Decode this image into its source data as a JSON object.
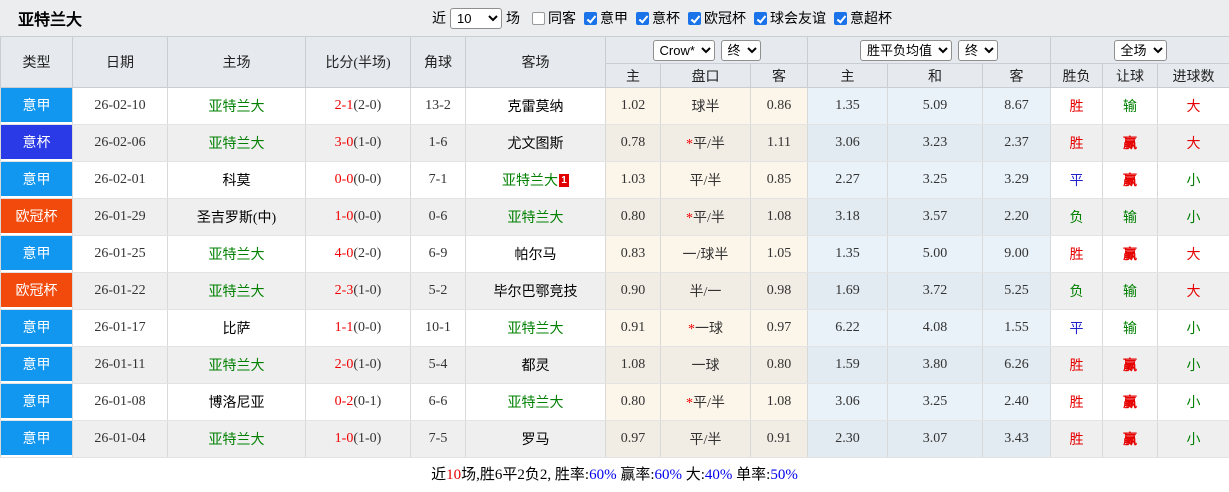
{
  "title": "亚特兰大",
  "topbar": {
    "recent_label": "近",
    "match_count": "10",
    "matches_label": "场",
    "checkboxes": [
      {
        "label": "同客",
        "checked": false
      },
      {
        "label": "意甲",
        "checked": true
      },
      {
        "label": "意杯",
        "checked": true
      },
      {
        "label": "欧冠杯",
        "checked": true
      },
      {
        "label": "球会友谊",
        "checked": true
      },
      {
        "label": "意超杯",
        "checked": true
      }
    ]
  },
  "table": {
    "headers": {
      "type": "类型",
      "date": "日期",
      "home": "主场",
      "score": "比分(半场)",
      "corners": "角球",
      "away": "客场",
      "sub": [
        "主",
        "盘口",
        "客",
        "主",
        "和",
        "客",
        "胜负",
        "让球",
        "进球数"
      ]
    },
    "selectors": {
      "bookmaker": "Crow*",
      "handicap_time": "终",
      "odds_avg": "胜平负均值",
      "odds_time": "终",
      "scope": "全场"
    },
    "type_colors": {
      "意甲": "#1297f0",
      "意杯": "#2a3ae6",
      "欧冠杯": "#f24a0c"
    },
    "rows": [
      {
        "type": "意甲",
        "date": "26-02-10",
        "home": "亚特兰大",
        "home_team": true,
        "score": "2-1",
        "half": "(2-0)",
        "corners": "13-2",
        "away": "克雷莫纳",
        "away_team": false,
        "away_card": "",
        "ah": {
          "home": "1.02",
          "star": false,
          "line": "球半",
          "away": "0.86"
        },
        "eu": {
          "home": "1.35",
          "draw": "5.09",
          "away": "8.67"
        },
        "result": {
          "text": "胜",
          "color": "red"
        },
        "handicap": {
          "text": "输",
          "color": "green"
        },
        "goals": {
          "text": "大",
          "color": "red"
        }
      },
      {
        "type": "意杯",
        "date": "26-02-06",
        "home": "亚特兰大",
        "home_team": true,
        "score": "3-0",
        "half": "(1-0)",
        "corners": "1-6",
        "away": "尤文图斯",
        "away_team": false,
        "away_card": "",
        "ah": {
          "home": "0.78",
          "star": true,
          "line": "平/半",
          "away": "1.11"
        },
        "eu": {
          "home": "3.06",
          "draw": "3.23",
          "away": "2.37"
        },
        "result": {
          "text": "胜",
          "color": "red"
        },
        "handicap": {
          "text": "赢",
          "color": "red"
        },
        "goals": {
          "text": "大",
          "color": "red"
        }
      },
      {
        "type": "意甲",
        "date": "26-02-01",
        "home": "科莫",
        "home_team": false,
        "score": "0-0",
        "half": "(0-0)",
        "corners": "7-1",
        "away": "亚特兰大",
        "away_team": true,
        "away_card": "1",
        "ah": {
          "home": "1.03",
          "star": false,
          "line": "平/半",
          "away": "0.85"
        },
        "eu": {
          "home": "2.27",
          "draw": "3.25",
          "away": "3.29"
        },
        "result": {
          "text": "平",
          "color": "blue"
        },
        "handicap": {
          "text": "赢",
          "color": "red"
        },
        "goals": {
          "text": "小",
          "color": "green"
        }
      },
      {
        "type": "欧冠杯",
        "date": "26-01-29",
        "home": "圣吉罗斯(中)",
        "home_team": false,
        "score": "1-0",
        "half": "(0-0)",
        "corners": "0-6",
        "away": "亚特兰大",
        "away_team": true,
        "away_card": "",
        "ah": {
          "home": "0.80",
          "star": true,
          "line": "平/半",
          "away": "1.08"
        },
        "eu": {
          "home": "3.18",
          "draw": "3.57",
          "away": "2.20"
        },
        "result": {
          "text": "负",
          "color": "green"
        },
        "handicap": {
          "text": "输",
          "color": "green"
        },
        "goals": {
          "text": "小",
          "color": "green"
        }
      },
      {
        "type": "意甲",
        "date": "26-01-25",
        "home": "亚特兰大",
        "home_team": true,
        "score": "4-0",
        "half": "(2-0)",
        "corners": "6-9",
        "away": "帕尔马",
        "away_team": false,
        "away_card": "",
        "ah": {
          "home": "0.83",
          "star": false,
          "line": "一/球半",
          "away": "1.05"
        },
        "eu": {
          "home": "1.35",
          "draw": "5.00",
          "away": "9.00"
        },
        "result": {
          "text": "胜",
          "color": "red"
        },
        "handicap": {
          "text": "赢",
          "color": "red"
        },
        "goals": {
          "text": "大",
          "color": "red"
        }
      },
      {
        "type": "欧冠杯",
        "date": "26-01-22",
        "home": "亚特兰大",
        "home_team": true,
        "score": "2-3",
        "half": "(1-0)",
        "corners": "5-2",
        "away": "毕尔巴鄂竞技",
        "away_team": false,
        "away_card": "",
        "ah": {
          "home": "0.90",
          "star": false,
          "line": "半/一",
          "away": "0.98"
        },
        "eu": {
          "home": "1.69",
          "draw": "3.72",
          "away": "5.25"
        },
        "result": {
          "text": "负",
          "color": "green"
        },
        "handicap": {
          "text": "输",
          "color": "green"
        },
        "goals": {
          "text": "大",
          "color": "red"
        }
      },
      {
        "type": "意甲",
        "date": "26-01-17",
        "home": "比萨",
        "home_team": false,
        "score": "1-1",
        "half": "(0-0)",
        "corners": "10-1",
        "away": "亚特兰大",
        "away_team": true,
        "away_card": "",
        "ah": {
          "home": "0.91",
          "star": true,
          "line": "一球",
          "away": "0.97"
        },
        "eu": {
          "home": "6.22",
          "draw": "4.08",
          "away": "1.55"
        },
        "result": {
          "text": "平",
          "color": "blue"
        },
        "handicap": {
          "text": "输",
          "color": "green"
        },
        "goals": {
          "text": "小",
          "color": "green"
        }
      },
      {
        "type": "意甲",
        "date": "26-01-11",
        "home": "亚特兰大",
        "home_team": true,
        "score": "2-0",
        "half": "(1-0)",
        "corners": "5-4",
        "away": "都灵",
        "away_team": false,
        "away_card": "",
        "ah": {
          "home": "1.08",
          "star": false,
          "line": "一球",
          "away": "0.80"
        },
        "eu": {
          "home": "1.59",
          "draw": "3.80",
          "away": "6.26"
        },
        "result": {
          "text": "胜",
          "color": "red"
        },
        "handicap": {
          "text": "赢",
          "color": "red"
        },
        "goals": {
          "text": "小",
          "color": "green"
        }
      },
      {
        "type": "意甲",
        "date": "26-01-08",
        "home": "博洛尼亚",
        "home_team": false,
        "score": "0-2",
        "half": "(0-1)",
        "corners": "6-6",
        "away": "亚特兰大",
        "away_team": true,
        "away_card": "",
        "ah": {
          "home": "0.80",
          "star": true,
          "line": "平/半",
          "away": "1.08"
        },
        "eu": {
          "home": "3.06",
          "draw": "3.25",
          "away": "2.40"
        },
        "result": {
          "text": "胜",
          "color": "red"
        },
        "handicap": {
          "text": "赢",
          "color": "red"
        },
        "goals": {
          "text": "小",
          "color": "green"
        }
      },
      {
        "type": "意甲",
        "date": "26-01-04",
        "home": "亚特兰大",
        "home_team": true,
        "score": "1-0",
        "half": "(1-0)",
        "corners": "7-5",
        "away": "罗马",
        "away_team": false,
        "away_card": "",
        "ah": {
          "home": "0.97",
          "star": false,
          "line": "平/半",
          "away": "0.91"
        },
        "eu": {
          "home": "2.30",
          "draw": "3.07",
          "away": "3.43"
        },
        "result": {
          "text": "胜",
          "color": "red"
        },
        "handicap": {
          "text": "赢",
          "color": "red"
        },
        "goals": {
          "text": "小",
          "color": "green"
        }
      }
    ]
  },
  "footer": {
    "segments": [
      {
        "text": "近",
        "color": "#000000"
      },
      {
        "text": "10",
        "color": "#e60000"
      },
      {
        "text": "场,胜6平2负2, 胜率:",
        "color": "#000000"
      },
      {
        "text": "60%",
        "color": "#0000ee"
      },
      {
        "text": " 赢率:",
        "color": "#000000"
      },
      {
        "text": "60%",
        "color": "#0000ee"
      },
      {
        "text": " 大:",
        "color": "#000000"
      },
      {
        "text": "40%",
        "color": "#0000ee"
      },
      {
        "text": " 单率:",
        "color": "#000000"
      },
      {
        "text": "50%",
        "color": "#0000ee"
      }
    ]
  }
}
